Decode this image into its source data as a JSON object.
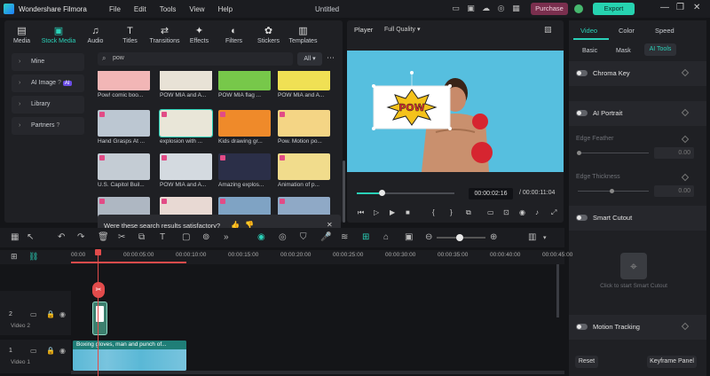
{
  "app": {
    "name": "Wondershare Filmora",
    "project": "Untitled"
  },
  "menu": [
    "File",
    "Edit",
    "Tools",
    "View",
    "Help"
  ],
  "toolbar": {
    "purchase": "Purchase",
    "export": "Export"
  },
  "media_tabs": [
    "Media",
    "Stock Media",
    "Audio",
    "Titles",
    "Transitions",
    "Effects",
    "Filters",
    "Stickers",
    "Templates"
  ],
  "media_sidebar": [
    "Mine",
    "AI Image",
    "Library",
    "Partners"
  ],
  "ai_badge": "AI",
  "search": {
    "value": "pow"
  },
  "filter": {
    "label": "All"
  },
  "stock_items": [
    "Pow! comic boo...",
    "POW MIA and A...",
    "POW MIA flag ...",
    "POW MIA and A...",
    "Hand Grasps At ...",
    "explosion with ...",
    "Kids drawing gr...",
    "Pow. Motion po...",
    "U.S. Capitol Buil...",
    "POW MIA and A...",
    "Amazing explos...",
    "Animation of p...",
    "",
    "",
    "",
    ""
  ],
  "feedback": {
    "text": "Were these search results satisfactory?"
  },
  "player": {
    "label": "Player",
    "quality": "Full Quality",
    "current": "00:00:02:16",
    "separator": "/",
    "total": "00:00:11:04",
    "progress": 0.23
  },
  "props": {
    "tabs": [
      "Video",
      "Color",
      "Speed"
    ],
    "subtabs": [
      "Basic",
      "Mask",
      "AI Tools"
    ],
    "sections": [
      "Chroma Key",
      "AI Portrait",
      "Smart Cutout",
      "Motion Tracking"
    ],
    "edge_feather": "Edge Feather",
    "edge_thickness": "Edge Thickness",
    "value": "0.00",
    "smart_cutout_hint": "Click to start Smart Cutout",
    "reset": "Reset",
    "keyframe": "Keyframe Panel"
  },
  "timeline": {
    "ticks": [
      "00:00",
      "00:00:05:00",
      "00:00:10:00",
      "00:00:15:00",
      "00:00:20:00",
      "00:00:25:00",
      "00:00:30:00",
      "00:00:35:00",
      "00:00:40:00",
      "00:00:45:00"
    ],
    "tracks": [
      {
        "label": "Video 2",
        "number": "2"
      },
      {
        "label": "Video 1",
        "number": "1"
      }
    ],
    "clip_video1": "Boxing gloves, man and punch of..."
  }
}
